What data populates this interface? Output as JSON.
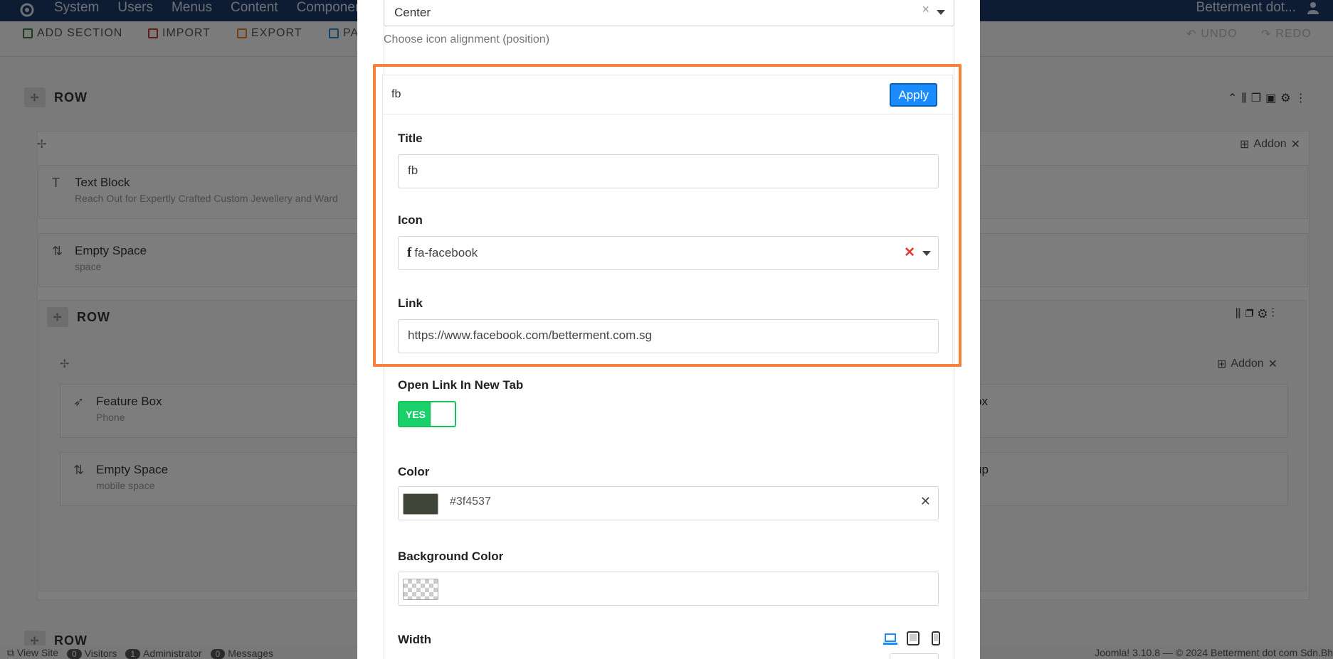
{
  "app": {
    "nav": [
      "System",
      "Users",
      "Menus",
      "Content",
      "Componen"
    ],
    "site_name": "Betterment dot..."
  },
  "toolbar": {
    "add_section": "ADD SECTION",
    "import": "IMPORT",
    "export": "EXPORT",
    "pages": "PA",
    "undo": "UNDO",
    "redo": "REDO"
  },
  "builder": {
    "row_label": "ROW",
    "addon_label": "Addon",
    "addons": [
      {
        "name": "Text Block",
        "sub": "Reach Out for Expertly Crafted Custom Jewellery and Ward"
      },
      {
        "name": "Empty Space",
        "sub": "space"
      },
      {
        "name": "Feature Box",
        "sub": "Phone"
      },
      {
        "name": "Empty Space",
        "sub": "mobile space"
      }
    ],
    "right_partial": [
      "ox",
      "up"
    ]
  },
  "status": {
    "view_site": "View Site",
    "visitors_count": "0",
    "visitors": "Visitors",
    "admin_count": "1",
    "admin": "Administrator",
    "messages_count": "0",
    "messages": "Messages",
    "footer": "Joomla! 3.10.8  —  © 2024 Betterment dot com Sdn.Bh"
  },
  "modal": {
    "alignment": {
      "value": "Center",
      "help": "Choose icon alignment (position)"
    },
    "item": {
      "header_title": "fb",
      "apply_label": "Apply",
      "title_label": "Title",
      "title_value": "fb",
      "icon_label": "Icon",
      "icon_value": "fa-facebook",
      "link_label": "Link",
      "link_value": "https://www.facebook.com/betterment.com.sg"
    },
    "open_new_tab": {
      "label": "Open Link In New Tab",
      "state": "YES"
    },
    "color": {
      "label": "Color",
      "value": "#3f4537",
      "swatch": "#3f4537"
    },
    "background_color": {
      "label": "Background Color"
    },
    "width": {
      "label": "Width"
    }
  },
  "colors": {
    "highlight": "#f5813c",
    "apply_button": "#1a8cff",
    "toggle_on": "#19d06a"
  }
}
